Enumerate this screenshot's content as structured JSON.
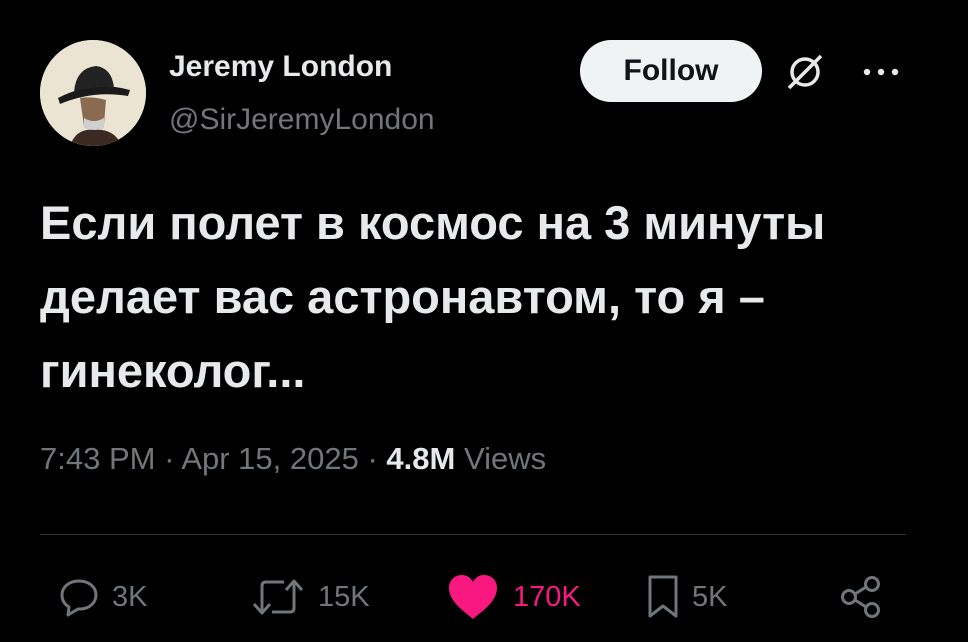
{
  "author": {
    "name": "Jeremy London",
    "handle": "@SirJeremyLondon"
  },
  "follow_label": "Follow",
  "tweet": {
    "text": "Если полет в космос на 3 минуты делает вас астронавтом, то я – гинеколог..."
  },
  "meta": {
    "time": "7:43 PM",
    "separator": "·",
    "date": "Apr 15, 2025",
    "views_count": "4.8M",
    "views_label": "Views"
  },
  "actions": {
    "replies": "3K",
    "reposts": "15K",
    "likes": "170K",
    "bookmarks": "5K"
  },
  "icons": [
    "avatar",
    "grok-icon",
    "more-icon",
    "reply-icon",
    "repost-icon",
    "like-icon",
    "bookmark-icon",
    "share-icon"
  ],
  "colors": {
    "background": "#000000",
    "text": "#e7e9ea",
    "muted": "#71767b",
    "like": "#f91880",
    "follow_bg": "#eff3f4"
  }
}
